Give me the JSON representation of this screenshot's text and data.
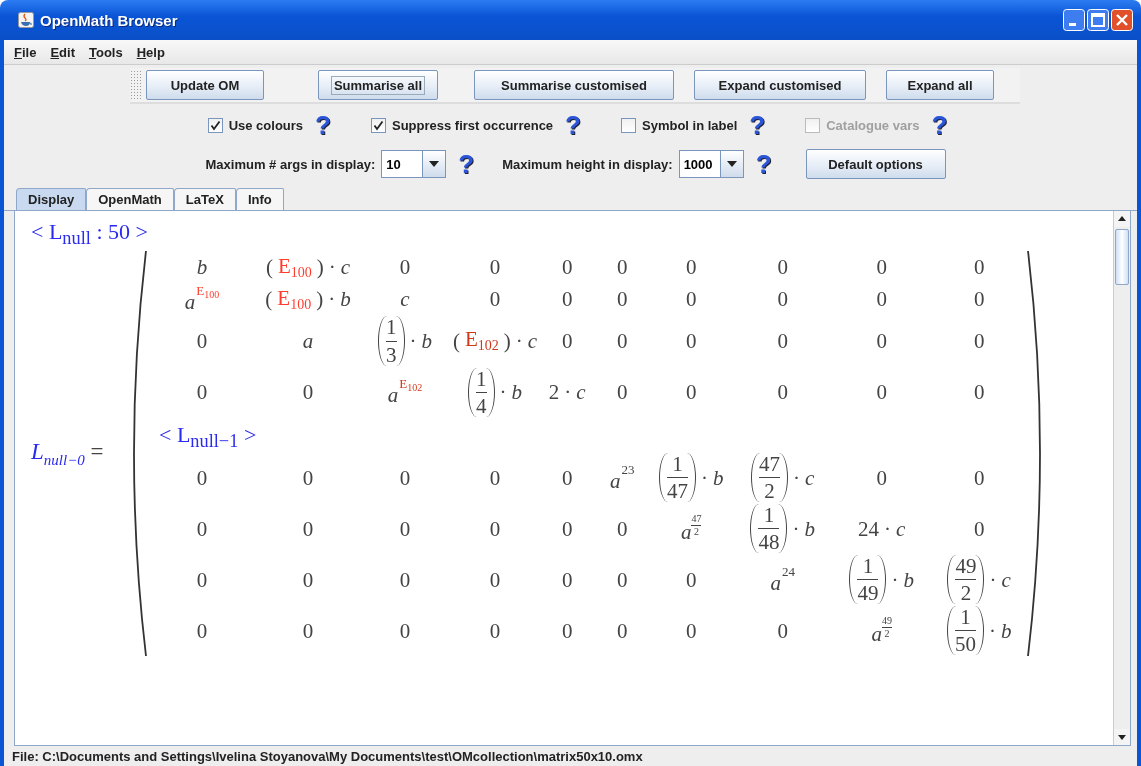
{
  "window": {
    "title": "OpenMath Browser"
  },
  "menu": [
    {
      "key": "F",
      "rest": "ile"
    },
    {
      "key": "E",
      "rest": "dit"
    },
    {
      "key": "T",
      "rest": "ools"
    },
    {
      "key": "H",
      "rest": "elp"
    }
  ],
  "toolbar": [
    {
      "label": "Update OM",
      "focused": false
    },
    {
      "label": "Summarise all",
      "focused": true
    },
    {
      "label": "Summarise customised",
      "focused": false
    },
    {
      "label": "Expand customised",
      "focused": false
    },
    {
      "label": "Expand all",
      "focused": false
    }
  ],
  "options": [
    {
      "label": "Use colours",
      "checked": true,
      "disabled": false,
      "help": "?"
    },
    {
      "label": "Suppress first occurrence",
      "checked": true,
      "disabled": false,
      "help": "?"
    },
    {
      "label": "Symbol in label",
      "checked": false,
      "disabled": false,
      "help": "?"
    },
    {
      "label": "Catalogue vars",
      "checked": false,
      "disabled": true,
      "help": "?"
    }
  ],
  "settings": [
    {
      "label": "Maximum # args in display:",
      "value": "10",
      "help": "?"
    },
    {
      "label": "Maximum height in display:",
      "value": "1000",
      "help": "?"
    }
  ],
  "default_button": "Default options",
  "tabs": [
    {
      "label": "Display",
      "selected": true
    },
    {
      "label": "OpenMath",
      "selected": false
    },
    {
      "label": "LaTeX",
      "selected": false
    },
    {
      "label": "Info",
      "selected": false
    }
  ],
  "display": {
    "title_label": "< L$_{null}$ : 50 >",
    "lhs": {
      "name": "L",
      "sub": "null−0",
      "eq": "="
    },
    "rows": [
      {
        "kind": "row",
        "cells": [
          [
            {
              "kind": "it",
              "text": "b"
            }
          ],
          [
            {
              "kind": "rm",
              "text": "("
            },
            {
              "kind": "sym",
              "text": "E",
              "sub": "100",
              "color": "#ff3d2e"
            },
            {
              "kind": "rm",
              "text": ")"
            },
            {
              "kind": "rm",
              "text": "·"
            },
            {
              "kind": "it",
              "text": "c"
            }
          ],
          [
            {
              "kind": "rm",
              "text": "0"
            }
          ],
          [
            {
              "kind": "rm",
              "text": "0"
            }
          ],
          [
            {
              "kind": "rm",
              "text": "0"
            }
          ],
          [
            {
              "kind": "rm",
              "text": "0"
            }
          ],
          [
            {
              "kind": "rm",
              "text": "0"
            }
          ],
          [
            {
              "kind": "rm",
              "text": "0"
            }
          ],
          [
            {
              "kind": "rm",
              "text": "0"
            }
          ],
          [
            {
              "kind": "rm",
              "text": "0"
            }
          ]
        ]
      },
      {
        "kind": "row",
        "cells": [
          [
            {
              "kind": "pow",
              "base": "a",
              "sup": "E",
              "sup_sub": "100",
              "color": "#ff3d2e"
            }
          ],
          [
            {
              "kind": "rm",
              "text": "("
            },
            {
              "kind": "sym",
              "text": "E",
              "sub": "100",
              "color": "#ff3d2e"
            },
            {
              "kind": "rm",
              "text": ")"
            },
            {
              "kind": "rm",
              "text": "·"
            },
            {
              "kind": "it",
              "text": "b"
            }
          ],
          [
            {
              "kind": "it",
              "text": "c"
            }
          ],
          [
            {
              "kind": "rm",
              "text": "0"
            }
          ],
          [
            {
              "kind": "rm",
              "text": "0"
            }
          ],
          [
            {
              "kind": "rm",
              "text": "0"
            }
          ],
          [
            {
              "kind": "rm",
              "text": "0"
            }
          ],
          [
            {
              "kind": "rm",
              "text": "0"
            }
          ],
          [
            {
              "kind": "rm",
              "text": "0"
            }
          ],
          [
            {
              "kind": "rm",
              "text": "0"
            }
          ]
        ]
      },
      {
        "kind": "row",
        "cells": [
          [
            {
              "kind": "rm",
              "text": "0"
            }
          ],
          [
            {
              "kind": "it",
              "text": "a"
            }
          ],
          [
            {
              "kind": "frac",
              "num": "1",
              "den": "3"
            },
            {
              "kind": "rm",
              "text": "·"
            },
            {
              "kind": "it",
              "text": "b"
            }
          ],
          [
            {
              "kind": "rm",
              "text": "("
            },
            {
              "kind": "sym",
              "text": "E",
              "sub": "102",
              "color": "#d0381a"
            },
            {
              "kind": "rm",
              "text": ")"
            },
            {
              "kind": "rm",
              "text": "·"
            },
            {
              "kind": "it",
              "text": "c"
            }
          ],
          [
            {
              "kind": "rm",
              "text": "0"
            }
          ],
          [
            {
              "kind": "rm",
              "text": "0"
            }
          ],
          [
            {
              "kind": "rm",
              "text": "0"
            }
          ],
          [
            {
              "kind": "rm",
              "text": "0"
            }
          ],
          [
            {
              "kind": "rm",
              "text": "0"
            }
          ],
          [
            {
              "kind": "rm",
              "text": "0"
            }
          ]
        ]
      },
      {
        "kind": "row",
        "cells": [
          [
            {
              "kind": "rm",
              "text": "0"
            }
          ],
          [
            {
              "kind": "rm",
              "text": "0"
            }
          ],
          [
            {
              "kind": "pow",
              "base": "a",
              "sup": "E",
              "sup_sub": "102",
              "color": "#d0381a"
            }
          ],
          [
            {
              "kind": "frac",
              "num": "1",
              "den": "4"
            },
            {
              "kind": "rm",
              "text": "·"
            },
            {
              "kind": "it",
              "text": "b"
            }
          ],
          [
            {
              "kind": "rm",
              "text": "2"
            },
            {
              "kind": "rm",
              "text": "·"
            },
            {
              "kind": "it",
              "text": "c"
            }
          ],
          [
            {
              "kind": "rm",
              "text": "0"
            }
          ],
          [
            {
              "kind": "rm",
              "text": "0"
            }
          ],
          [
            {
              "kind": "rm",
              "text": "0"
            }
          ],
          [
            {
              "kind": "rm",
              "text": "0"
            }
          ],
          [
            {
              "kind": "rm",
              "text": "0"
            }
          ]
        ]
      },
      {
        "kind": "label",
        "text": "< L$_{null−1}$ >"
      },
      {
        "kind": "row",
        "cells": [
          [
            {
              "kind": "rm",
              "text": "0"
            }
          ],
          [
            {
              "kind": "rm",
              "text": "0"
            }
          ],
          [
            {
              "kind": "rm",
              "text": "0"
            }
          ],
          [
            {
              "kind": "rm",
              "text": "0"
            }
          ],
          [
            {
              "kind": "rm",
              "text": "0"
            }
          ],
          [
            {
              "kind": "pow",
              "base": "a",
              "sup": "23"
            }
          ],
          [
            {
              "kind": "frac",
              "num": "1",
              "den": "47"
            },
            {
              "kind": "rm",
              "text": "·"
            },
            {
              "kind": "it",
              "text": "b"
            }
          ],
          [
            {
              "kind": "frac",
              "num": "47",
              "den": "2"
            },
            {
              "kind": "rm",
              "text": "·"
            },
            {
              "kind": "it",
              "text": "c"
            }
          ],
          [
            {
              "kind": "rm",
              "text": "0"
            }
          ],
          [
            {
              "kind": "rm",
              "text": "0"
            }
          ]
        ]
      },
      {
        "kind": "row",
        "cells": [
          [
            {
              "kind": "rm",
              "text": "0"
            }
          ],
          [
            {
              "kind": "rm",
              "text": "0"
            }
          ],
          [
            {
              "kind": "rm",
              "text": "0"
            }
          ],
          [
            {
              "kind": "rm",
              "text": "0"
            }
          ],
          [
            {
              "kind": "rm",
              "text": "0"
            }
          ],
          [
            {
              "kind": "rm",
              "text": "0"
            }
          ],
          [
            {
              "kind": "powfrac",
              "base": "a",
              "num": "47",
              "den": "2"
            }
          ],
          [
            {
              "kind": "frac",
              "num": "1",
              "den": "48"
            },
            {
              "kind": "rm",
              "text": "·"
            },
            {
              "kind": "it",
              "text": "b"
            }
          ],
          [
            {
              "kind": "rm",
              "text": "24"
            },
            {
              "kind": "rm",
              "text": "·"
            },
            {
              "kind": "it",
              "text": "c"
            }
          ],
          [
            {
              "kind": "rm",
              "text": "0"
            }
          ]
        ]
      },
      {
        "kind": "row",
        "cells": [
          [
            {
              "kind": "rm",
              "text": "0"
            }
          ],
          [
            {
              "kind": "rm",
              "text": "0"
            }
          ],
          [
            {
              "kind": "rm",
              "text": "0"
            }
          ],
          [
            {
              "kind": "rm",
              "text": "0"
            }
          ],
          [
            {
              "kind": "rm",
              "text": "0"
            }
          ],
          [
            {
              "kind": "rm",
              "text": "0"
            }
          ],
          [
            {
              "kind": "rm",
              "text": "0"
            }
          ],
          [
            {
              "kind": "pow",
              "base": "a",
              "sup": "24"
            }
          ],
          [
            {
              "kind": "frac",
              "num": "1",
              "den": "49"
            },
            {
              "kind": "rm",
              "text": "·"
            },
            {
              "kind": "it",
              "text": "b"
            }
          ],
          [
            {
              "kind": "frac",
              "num": "49",
              "den": "2"
            },
            {
              "kind": "rm",
              "text": "·"
            },
            {
              "kind": "it",
              "text": "c"
            }
          ]
        ]
      },
      {
        "kind": "row",
        "cells": [
          [
            {
              "kind": "rm",
              "text": "0"
            }
          ],
          [
            {
              "kind": "rm",
              "text": "0"
            }
          ],
          [
            {
              "kind": "rm",
              "text": "0"
            }
          ],
          [
            {
              "kind": "rm",
              "text": "0"
            }
          ],
          [
            {
              "kind": "rm",
              "text": "0"
            }
          ],
          [
            {
              "kind": "rm",
              "text": "0"
            }
          ],
          [
            {
              "kind": "rm",
              "text": "0"
            }
          ],
          [
            {
              "kind": "rm",
              "text": "0"
            }
          ],
          [
            {
              "kind": "powfrac",
              "base": "a",
              "num": "49",
              "den": "2"
            }
          ],
          [
            {
              "kind": "frac",
              "num": "1",
              "den": "50"
            },
            {
              "kind": "rm",
              "text": "·"
            },
            {
              "kind": "it",
              "text": "b"
            }
          ]
        ]
      }
    ]
  },
  "status_bar": "File: C:\\Documents and Settings\\Ivelina Stoyanova\\My Documents\\test\\OMcollection\\matrix50x10.omx"
}
